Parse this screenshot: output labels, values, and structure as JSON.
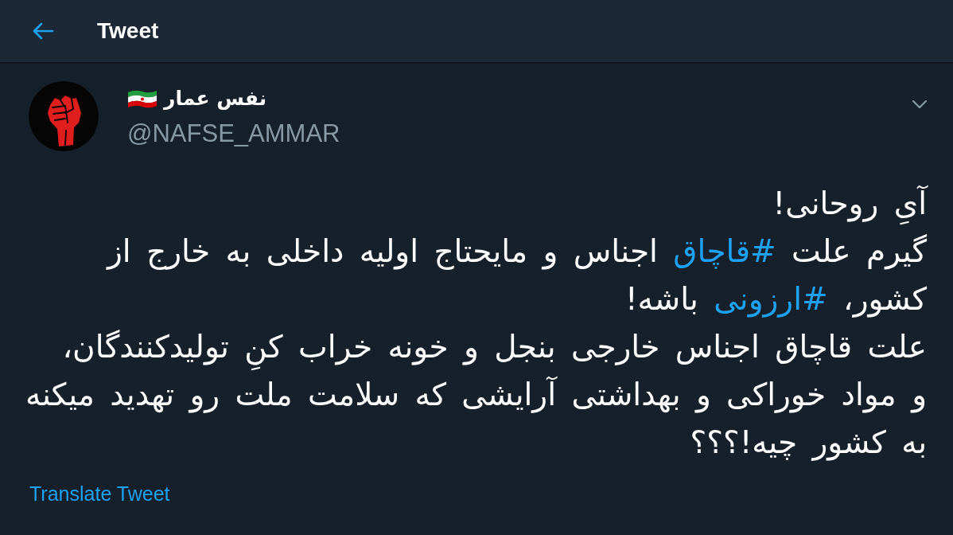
{
  "header": {
    "title": "Tweet"
  },
  "tweet": {
    "author": {
      "name": "نفس عمار",
      "handle": "@NAFSE_AMMAR"
    },
    "body": [
      {
        "kind": "text",
        "text": "آیِ روحانی!\nگیرم علت "
      },
      {
        "kind": "hashtag",
        "text": "#قاچاق"
      },
      {
        "kind": "text",
        "text": " اجناس و مایحتاج اولیه داخلی به خارج از\nکشور، "
      },
      {
        "kind": "hashtag",
        "text": "#ارزونی"
      },
      {
        "kind": "text",
        "text": " باشه!\nعلت قاچاق اجناس خارجی بنجل و خونه خراب کنِ تولیدکنندگان،\nو مواد خوراکی و بهداشتی آرایشی که سلامت ملت رو تهدید میکنه\nبه کشور چیه!؟؟؟"
      }
    ],
    "translate_link": "Translate Tweet"
  }
}
